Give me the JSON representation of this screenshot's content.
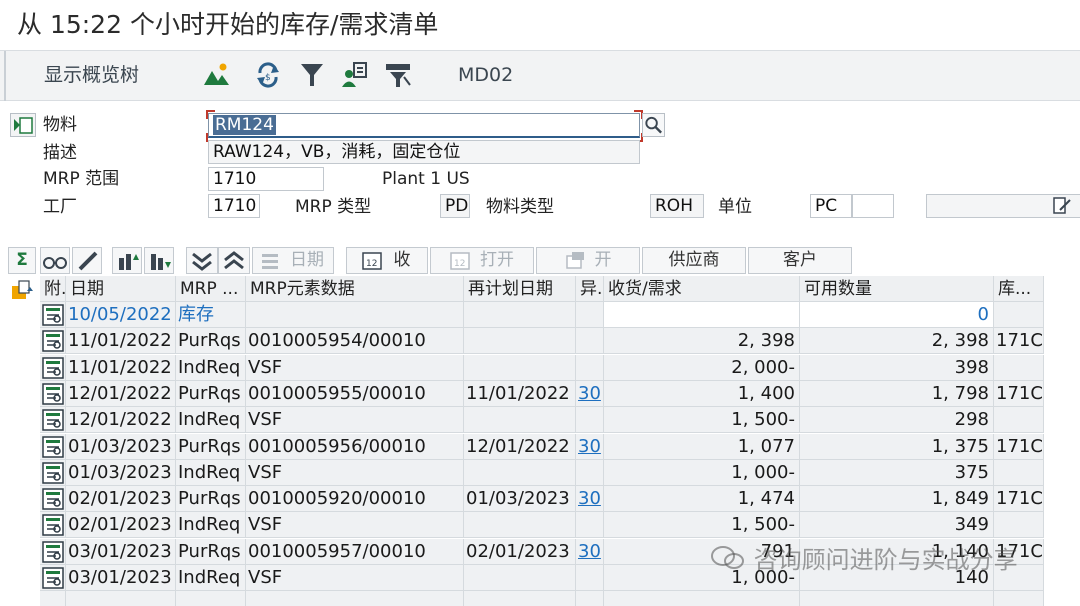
{
  "window": {
    "title": "从 15:22 个小时开始的库存/需求清单"
  },
  "toolbar": {
    "overview_tree": "显示概览树",
    "transaction": "MD02",
    "icons": [
      "mountain-icon",
      "refresh-icon",
      "filter-icon",
      "person-chart-icon",
      "funnel-table-icon"
    ]
  },
  "header": {
    "material_label": "物料",
    "material_value": "RM124",
    "desc_label": "描述",
    "desc_value": "RAW124，VB，消耗，固定仓位",
    "mrp_area_label": "MRP 范围",
    "mrp_area_value": "1710",
    "mrp_area_text": "Plant 1 US",
    "plant_label": "工厂",
    "plant_value": "1710",
    "mrp_type_label": "MRP 类型",
    "mrp_type_value": "PD",
    "mat_type_label": "物料类型",
    "mat_type_value": "ROH",
    "unit_label": "单位",
    "unit_value": "PC"
  },
  "buttons": {
    "sum_symbol": "Σ",
    "date": "日期",
    "receipts": "收",
    "open": "打开",
    "open2": "开",
    "vendor": "供应商",
    "customer": "客户"
  },
  "table": {
    "columns": [
      "附.",
      "日期",
      "MRP ...",
      "MRP元素数据",
      "再计划日期",
      "异.",
      "收货/需求",
      "可用数量",
      "库..."
    ],
    "rows": [
      {
        "date": "10/05/2022",
        "mrp": "库存",
        "data": "",
        "resched": "",
        "exc": "",
        "qty": "",
        "avail": "0",
        "stor": ""
      },
      {
        "date": "11/01/2022",
        "mrp": "PurRqs",
        "data": "0010005954/00010",
        "resched": "",
        "exc": "",
        "qty": "2, 398",
        "avail": "2, 398",
        "stor": "171C"
      },
      {
        "date": "11/01/2022",
        "mrp": "IndReq",
        "data": "VSF",
        "resched": "",
        "exc": "",
        "qty": "2, 000-",
        "avail": "398",
        "stor": ""
      },
      {
        "date": "12/01/2022",
        "mrp": "PurRqs",
        "data": "0010005955/00010",
        "resched": "11/01/2022",
        "exc": "30",
        "qty": "1, 400",
        "avail": "1, 798",
        "stor": "171C"
      },
      {
        "date": "12/01/2022",
        "mrp": "IndReq",
        "data": "VSF",
        "resched": "",
        "exc": "",
        "qty": "1, 500-",
        "avail": "298",
        "stor": ""
      },
      {
        "date": "01/03/2023",
        "mrp": "PurRqs",
        "data": "0010005956/00010",
        "resched": "12/01/2022",
        "exc": "30",
        "qty": "1, 077",
        "avail": "1, 375",
        "stor": "171C"
      },
      {
        "date": "01/03/2023",
        "mrp": "IndReq",
        "data": "VSF",
        "resched": "",
        "exc": "",
        "qty": "1, 000-",
        "avail": "375",
        "stor": ""
      },
      {
        "date": "02/01/2023",
        "mrp": "PurRqs",
        "data": "0010005920/00010",
        "resched": "01/03/2023",
        "exc": "30",
        "qty": "1, 474",
        "avail": "1, 849",
        "stor": "171C"
      },
      {
        "date": "02/01/2023",
        "mrp": "IndReq",
        "data": "VSF",
        "resched": "",
        "exc": "",
        "qty": "1, 500-",
        "avail": "349",
        "stor": ""
      },
      {
        "date": "03/01/2023",
        "mrp": "PurRqs",
        "data": "0010005957/00010",
        "resched": "02/01/2023",
        "exc": "30",
        "qty": "791",
        "avail": "1, 140",
        "stor": "171C"
      },
      {
        "date": "03/01/2023",
        "mrp": "IndReq",
        "data": "VSF",
        "resched": "",
        "exc": "",
        "qty": "1, 000-",
        "avail": "140",
        "stor": ""
      }
    ]
  },
  "watermark": "咨询顾问进阶与实战分享",
  "colors": {
    "link": "#1e6fbf",
    "cell_bg": "#eff1f3",
    "selection": "#4a6d94"
  }
}
